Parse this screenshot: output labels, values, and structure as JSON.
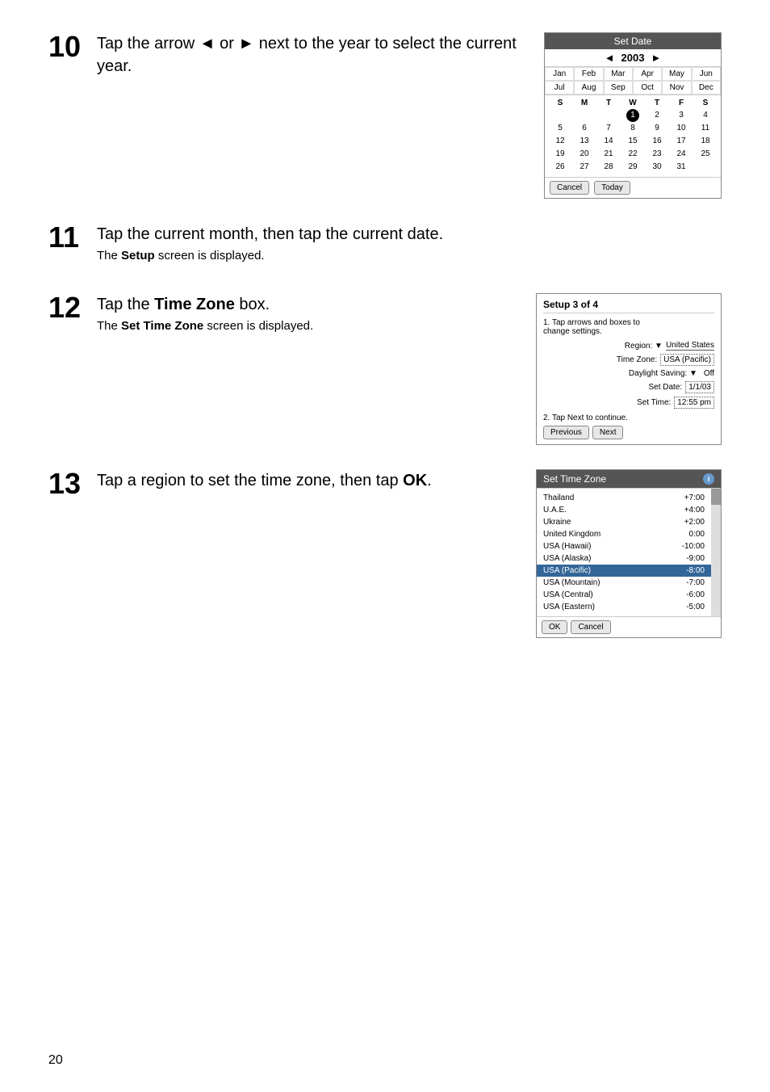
{
  "page": {
    "number": "20"
  },
  "step10": {
    "number": "10",
    "title": "Tap the arrow ◄ or ► next to the year to select the current year.",
    "calendar": {
      "header": "Set Date",
      "year": "2003",
      "prev_arrow": "◄",
      "next_arrow": "►",
      "months_row1": [
        "Jan",
        "Feb",
        "Mar",
        "Apr",
        "May",
        "Jun"
      ],
      "months_row2": [
        "Jul",
        "Aug",
        "Sep",
        "Oct",
        "Nov",
        "Dec"
      ],
      "days_header": [
        "S",
        "M",
        "T",
        "W",
        "T",
        "F",
        "S"
      ],
      "week1": [
        "",
        "",
        "",
        "1",
        "2",
        "3",
        "4"
      ],
      "week2": [
        "5",
        "6",
        "7",
        "8",
        "9",
        "10",
        "11"
      ],
      "week3": [
        "12",
        "13",
        "14",
        "15",
        "16",
        "17",
        "18"
      ],
      "week4": [
        "19",
        "20",
        "21",
        "22",
        "23",
        "24",
        "25"
      ],
      "week5": [
        "26",
        "27",
        "28",
        "29",
        "30",
        "31",
        ""
      ],
      "cancel_btn": "Cancel",
      "today_btn": "Today"
    }
  },
  "step11": {
    "number": "11",
    "title": "Tap the current month, then tap the current date.",
    "subtitle_prefix": "The ",
    "subtitle_bold": "Setup",
    "subtitle_suffix": " screen is displayed."
  },
  "step12": {
    "number": "12",
    "title_prefix": "Tap the ",
    "title_bold": "Time Zone",
    "title_suffix": " box.",
    "subtitle_prefix": "The ",
    "subtitle_bold": "Set Time Zone",
    "subtitle_suffix": " screen is displayed.",
    "setup": {
      "header": "Setup  3 of 4",
      "instruction1": "1. Tap arrows and boxes to",
      "instruction2": "change settings.",
      "region_label": "Region: ▼",
      "region_value": "United States",
      "timezone_label": "Time Zone:",
      "timezone_value": "USA (Pacific)",
      "daylight_label": "Daylight Saving: ▼",
      "daylight_value": "Off",
      "setdate_label": "Set Date:",
      "setdate_value": "1/1/03",
      "settime_label": "Set Time:",
      "settime_value": "12:55 pm",
      "instruction3": "2. Tap Next to continue.",
      "prev_btn": "Previous",
      "next_btn": "Next"
    }
  },
  "step13": {
    "number": "13",
    "title_prefix": "Tap a region to set the time zone, then tap ",
    "title_bold": "OK",
    "title_suffix": ".",
    "timezone_widget": {
      "header": "Set Time Zone",
      "info_icon": "i",
      "zones": [
        {
          "name": "Thailand",
          "offset": "+7:00"
        },
        {
          "name": "U.A.E.",
          "offset": "+4:00"
        },
        {
          "name": "Ukraine",
          "offset": "+2:00"
        },
        {
          "name": "United Kingdom",
          "offset": "0:00"
        },
        {
          "name": "USA (Hawaii)",
          "offset": "-10:00"
        },
        {
          "name": "USA (Alaska)",
          "offset": "-9:00"
        },
        {
          "name": "USA (Pacific)",
          "offset": "-8:00",
          "selected": true
        },
        {
          "name": "USA (Mountain)",
          "offset": "-7:00"
        },
        {
          "name": "USA (Central)",
          "offset": "-6:00"
        },
        {
          "name": "USA (Eastern)",
          "offset": "-5:00"
        }
      ],
      "ok_btn": "OK",
      "cancel_btn": "Cancel"
    }
  }
}
